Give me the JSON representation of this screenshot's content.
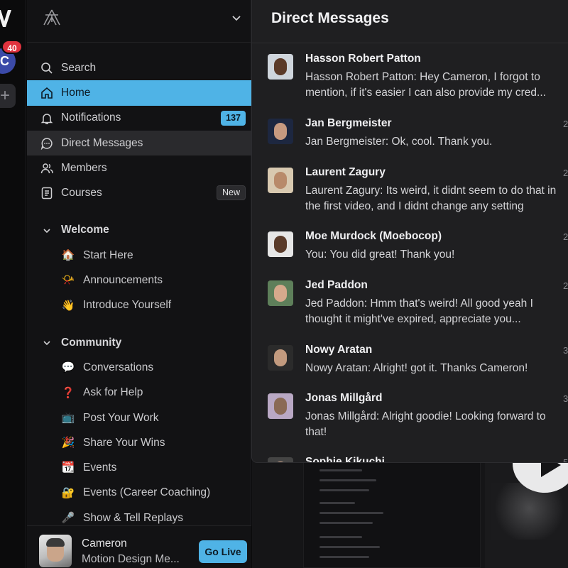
{
  "rail": {
    "badge": "40",
    "workspace_initial": "C",
    "add_symbol": "+"
  },
  "sidebar": {
    "nav": [
      {
        "label": "Search",
        "icon": "search-icon"
      },
      {
        "label": "Home",
        "icon": "home-icon"
      },
      {
        "label": "Notifications",
        "icon": "bell-icon",
        "count": "137"
      },
      {
        "label": "Direct Messages",
        "icon": "chat-bubble-icon"
      },
      {
        "label": "Members",
        "icon": "members-icon"
      },
      {
        "label": "Courses",
        "icon": "courses-icon",
        "tag": "New"
      }
    ],
    "sections": [
      {
        "title": "Welcome",
        "items": [
          {
            "label": "Start Here",
            "emoji": "🏠"
          },
          {
            "label": "Announcements",
            "emoji": "📯"
          },
          {
            "label": "Introduce Yourself",
            "emoji": "👋"
          }
        ]
      },
      {
        "title": "Community",
        "items": [
          {
            "label": "Conversations",
            "emoji": "💬"
          },
          {
            "label": "Ask for Help",
            "emoji": "❓"
          },
          {
            "label": "Post Your Work",
            "emoji": "📺"
          },
          {
            "label": "Share Your Wins",
            "emoji": "🎉"
          },
          {
            "label": "Events",
            "emoji": "📆"
          },
          {
            "label": "Events (Career Coaching)",
            "emoji": "🔐"
          },
          {
            "label": "Show & Tell Replays",
            "emoji": "🎤"
          }
        ]
      }
    ],
    "user": {
      "name": "Cameron",
      "subtitle": "Motion Design Me...",
      "go_live": "Go Live"
    }
  },
  "dm": {
    "title": "Direct Messages",
    "threads": [
      {
        "name": "Hasson Robert Patton",
        "message": "Hasson Robert Patton: Hey Cameron, I forgot to mention, if it's easier I can also provide my cred...",
        "time": ""
      },
      {
        "name": "Jan Bergmeister",
        "message": "Jan Bergmeister: Ok, cool. Thank you.",
        "time": "2"
      },
      {
        "name": "Laurent Zagury",
        "message": "Laurent Zagury: Its weird, it didnt seem to do that in the first video, and I didnt change any setting",
        "time": "2"
      },
      {
        "name": "Moe Murdock (Moebocop)",
        "message": "You: You did great! Thank you!",
        "time": "2"
      },
      {
        "name": "Jed Paddon",
        "message": "Jed Paddon: Hmm that's weird! All good yeah I thought it might've expired, appreciate you...",
        "time": "2"
      },
      {
        "name": "Nowy Aratan",
        "message": "Nowy Aratan: Alright! got it. Thanks Cameron!",
        "time": "3"
      },
      {
        "name": "Jonas Millgård",
        "message": "Jonas Millgård: Alright goodie! Looking forward to that!",
        "time": "3"
      },
      {
        "name": "Sophie Kikuchi",
        "message": "",
        "time": "5"
      }
    ]
  }
}
